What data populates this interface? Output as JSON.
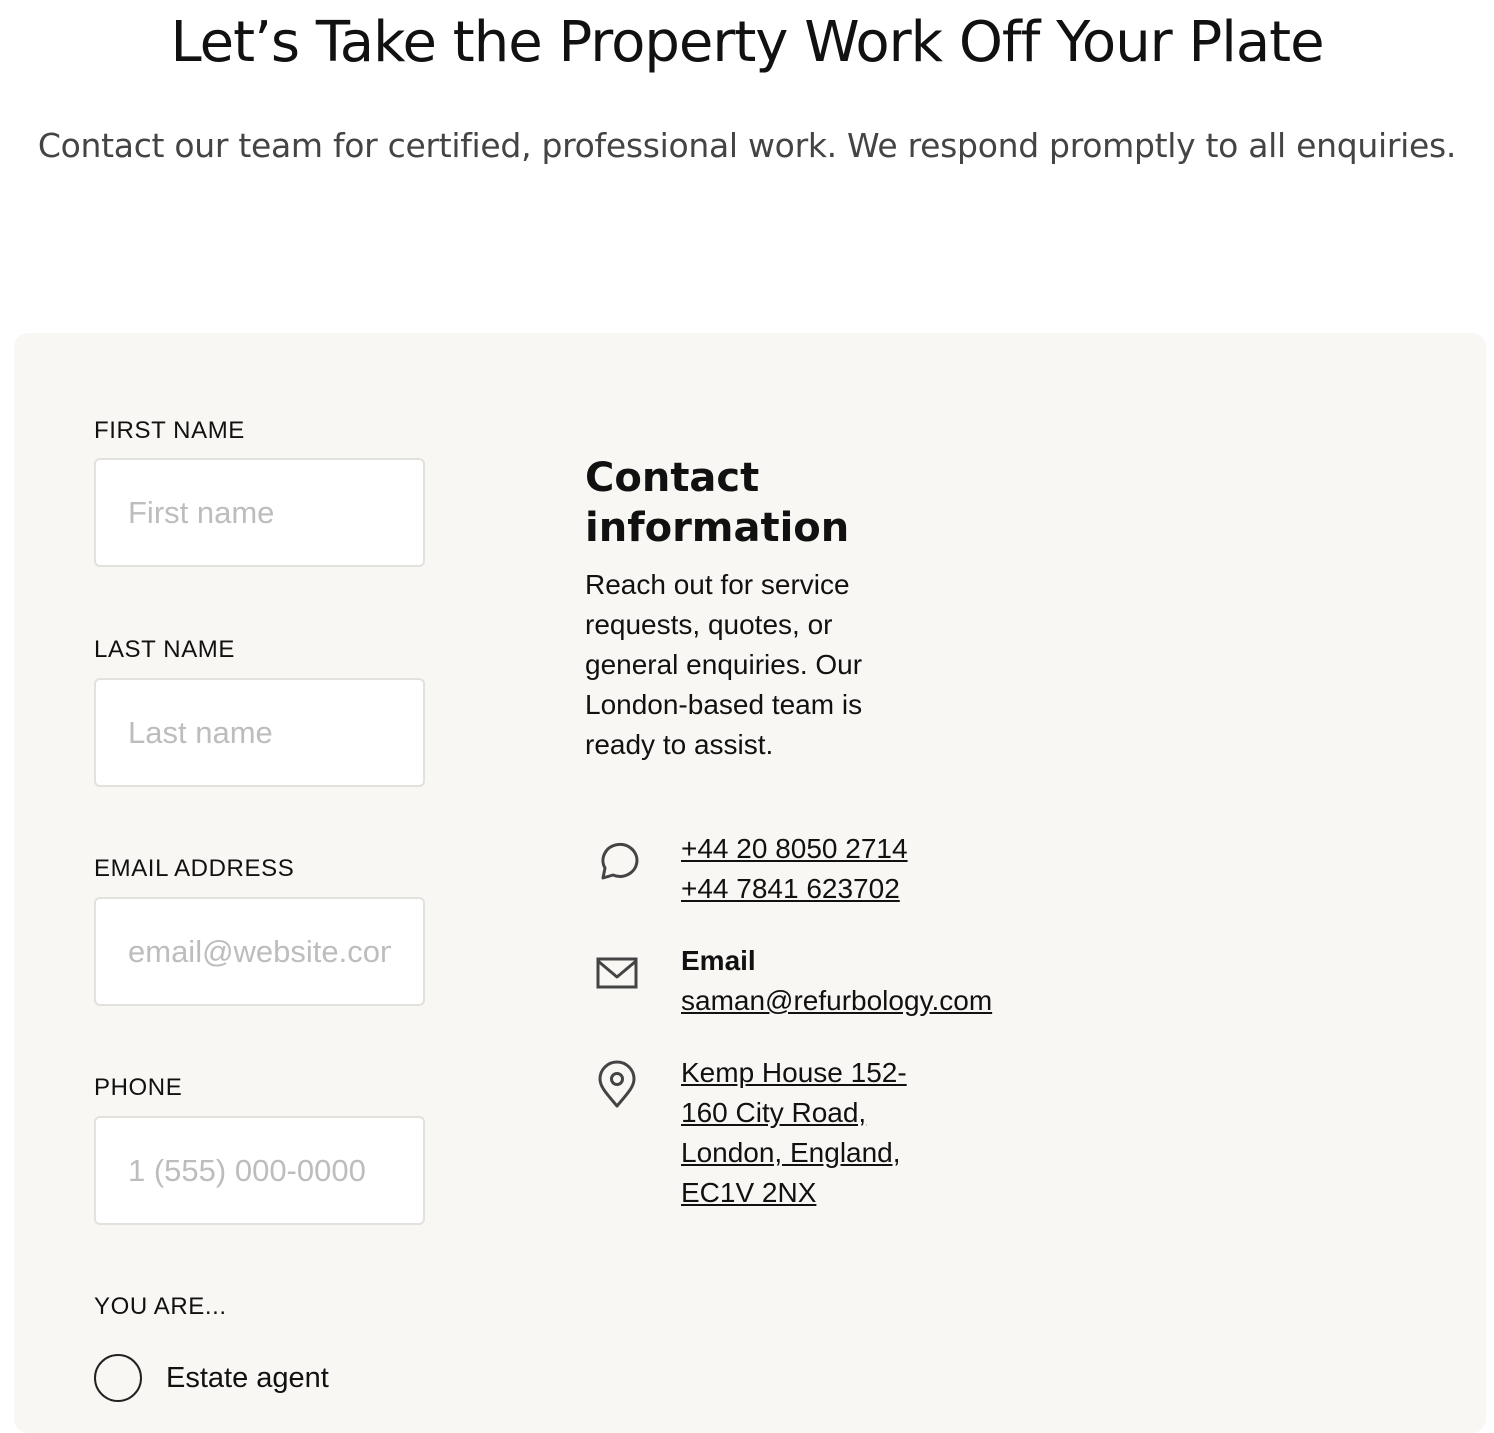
{
  "hero": {
    "title": "Let’s Take the Property Work Off Your Plate",
    "subtitle": "Contact our team for certified, professional work. We respond promptly to all enquiries."
  },
  "form": {
    "first_name": {
      "label": "FIRST NAME",
      "placeholder": "First name",
      "value": ""
    },
    "last_name": {
      "label": "LAST NAME",
      "placeholder": "Last name",
      "value": ""
    },
    "email": {
      "label": "EMAIL ADDRESS",
      "placeholder": "email@website.com",
      "value": ""
    },
    "phone": {
      "label": "PHONE",
      "placeholder": "1 (555) 000-0000",
      "value": ""
    },
    "you_are": {
      "label": "YOU ARE...",
      "options": [
        {
          "label": "Estate agent",
          "selected": false
        }
      ]
    }
  },
  "contact": {
    "heading": "Contact information",
    "description": "Reach out for service requests, quotes, or general enquiries. Our London-based team is ready to assist.",
    "phone": {
      "icon": "chat-bubble-icon",
      "numbers": [
        "+44 20 8050 2714",
        "+44 7841 623702"
      ]
    },
    "email": {
      "icon": "envelope-icon",
      "label": "Email",
      "address": "saman@refurbology.com"
    },
    "address": {
      "icon": "map-pin-icon",
      "text": "Kemp House 152-160 City Road, London, England, EC1V 2NX"
    }
  },
  "colors": {
    "panel_bg": "#f8f7f4",
    "input_border": "#e3e1dc",
    "placeholder": "#bdbdbd",
    "subtitle_text": "#444444"
  }
}
